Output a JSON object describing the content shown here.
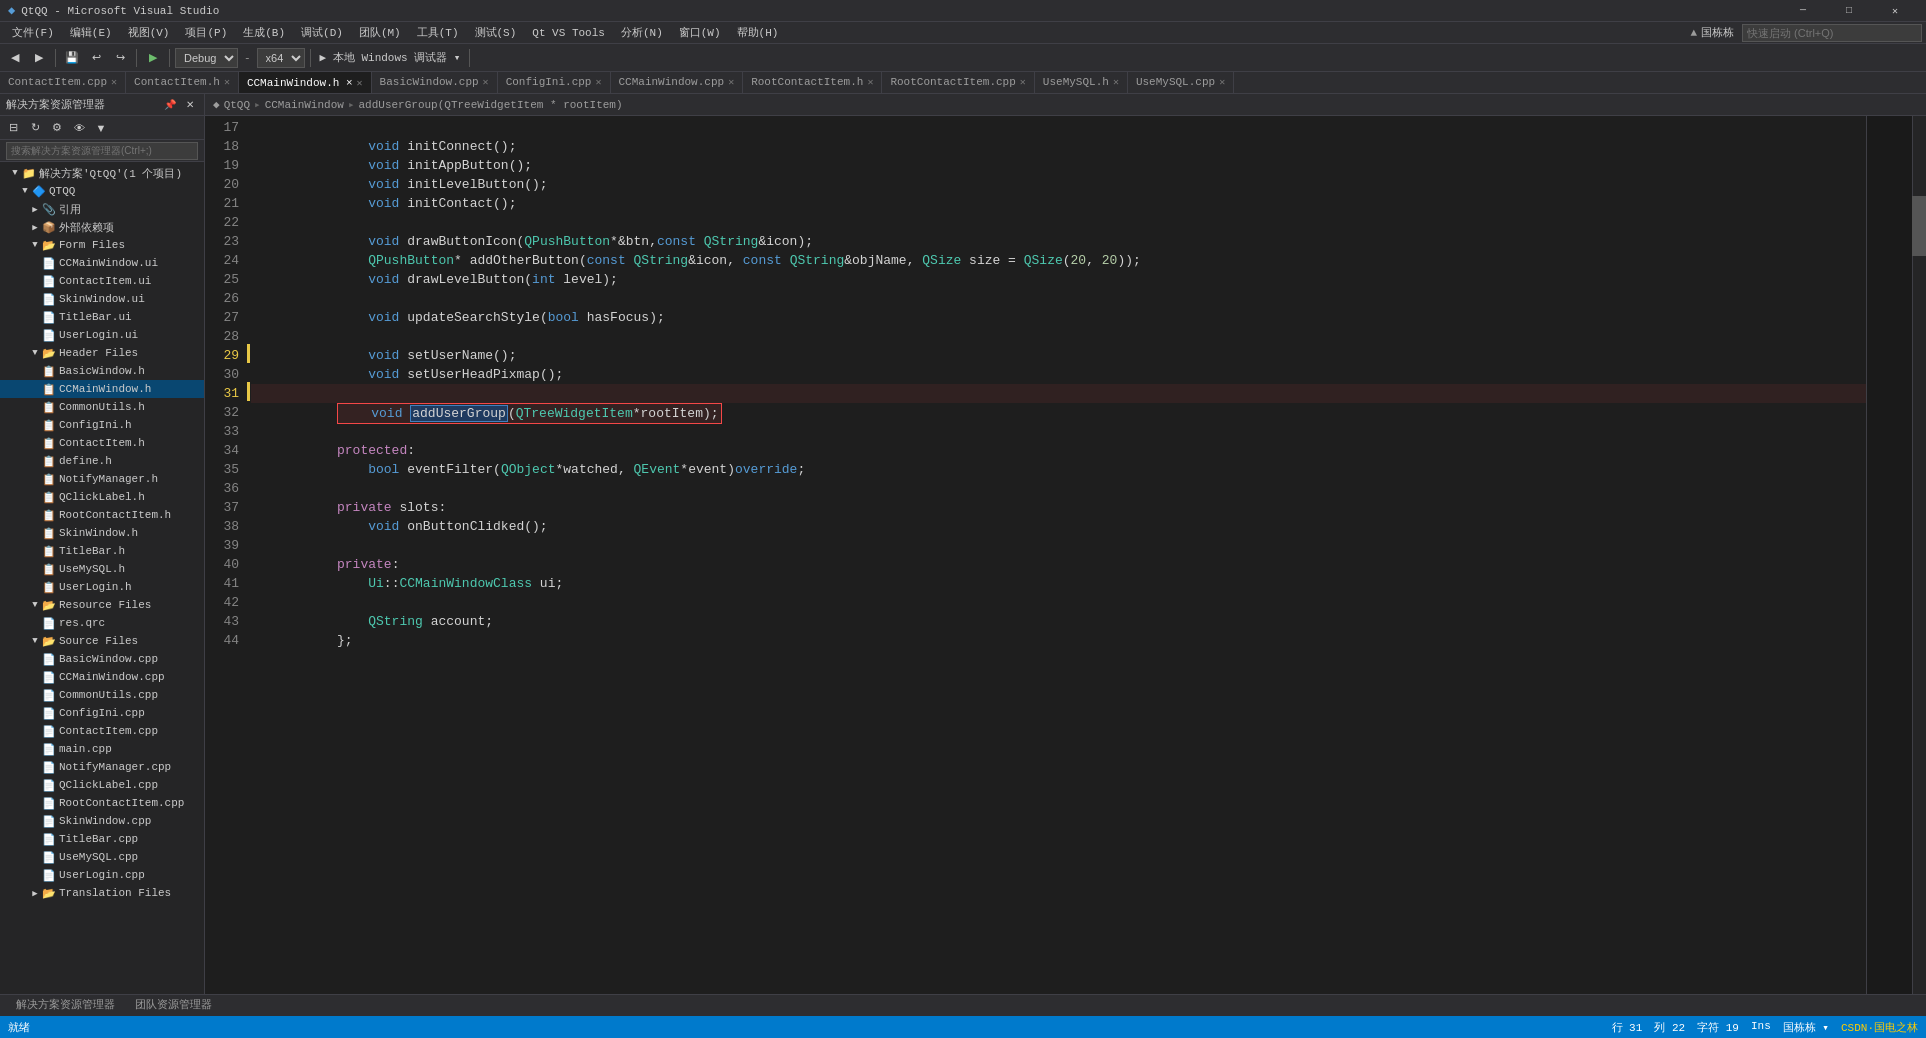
{
  "titleBar": {
    "icon": "◆",
    "title": "QtQQ - Microsoft Visual Studio",
    "btnMinimize": "─",
    "btnMaximize": "□",
    "btnClose": "✕"
  },
  "menuBar": {
    "items": [
      "文件(F)",
      "编辑(E)",
      "视图(V)",
      "项目(P)",
      "生成(B)",
      "调试(D)",
      "团队(M)",
      "工具(T)",
      "测试(S)",
      "Qt VS Tools",
      "分析(N)",
      "窗口(W)",
      "帮助(H)"
    ]
  },
  "toolbar": {
    "debugMode": "Debug",
    "platform": "x64",
    "runTarget": "本地 Windows 调试器",
    "searchPlaceholder": "快速启动 (Ctrl+Q)"
  },
  "tabs": [
    {
      "name": "ContactItem.cpp",
      "active": false,
      "modified": false
    },
    {
      "name": "ContactItem.h",
      "active": false,
      "modified": false
    },
    {
      "name": "CCMainWindow.h",
      "active": true,
      "modified": true
    },
    {
      "name": "BasicWindow.cpp",
      "active": false,
      "modified": false
    },
    {
      "name": "ConfigIni.cpp",
      "active": false,
      "modified": false
    },
    {
      "name": "CCMainWindow.cpp",
      "active": false,
      "modified": false
    },
    {
      "name": "RootContactItem.h",
      "active": false,
      "modified": false
    },
    {
      "name": "RootContactItem.cpp",
      "active": false,
      "modified": false
    },
    {
      "name": "UseMySQL.h",
      "active": false,
      "modified": false
    },
    {
      "name": "UseMySQL.cpp",
      "active": false,
      "modified": false
    }
  ],
  "breadcrumb": {
    "project": "QtQQ",
    "separator1": "▸",
    "class": "CCMainWindow",
    "separator2": "▸",
    "method": "addUserGroup(QTreeWidgetItem * rootItem)"
  },
  "solutionExplorer": {
    "title": "解决方案资源管理器",
    "searchPlaceholder": "搜索解决方案资源管理器(Ctrl+;)",
    "solution": "解决方案'QtQQ'(1 个项目)",
    "project": "QTQQ",
    "tree": [
      {
        "label": "引用",
        "indent": 2,
        "type": "folder",
        "expanded": false
      },
      {
        "label": "外部依赖项",
        "indent": 2,
        "type": "folder",
        "expanded": false
      },
      {
        "label": "Form Files",
        "indent": 2,
        "type": "folder",
        "expanded": true
      },
      {
        "label": "CCMainWindow.ui",
        "indent": 4,
        "type": "file-ui"
      },
      {
        "label": "ContactItem.ui",
        "indent": 4,
        "type": "file-ui"
      },
      {
        "label": "SkinWindow.ui",
        "indent": 4,
        "type": "file-ui"
      },
      {
        "label": "TitleBar.ui",
        "indent": 4,
        "type": "file-ui"
      },
      {
        "label": "UserLogin.ui",
        "indent": 4,
        "type": "file-ui"
      },
      {
        "label": "Header Files",
        "indent": 2,
        "type": "folder",
        "expanded": true
      },
      {
        "label": "BasicWindow.h",
        "indent": 4,
        "type": "file-h"
      },
      {
        "label": "CCMainWindow.h",
        "indent": 4,
        "type": "file-h",
        "selected": true
      },
      {
        "label": "CommonUtils.h",
        "indent": 4,
        "type": "file-h"
      },
      {
        "label": "ConfigIni.h",
        "indent": 4,
        "type": "file-h"
      },
      {
        "label": "ContactItem.h",
        "indent": 4,
        "type": "file-h"
      },
      {
        "label": "define.h",
        "indent": 4,
        "type": "file-h"
      },
      {
        "label": "NotifyManager.h",
        "indent": 4,
        "type": "file-h"
      },
      {
        "label": "QClickLabel.h",
        "indent": 4,
        "type": "file-h"
      },
      {
        "label": "RootContactItem.h",
        "indent": 4,
        "type": "file-h"
      },
      {
        "label": "SkinWindow.h",
        "indent": 4,
        "type": "file-h"
      },
      {
        "label": "TitleBar.h",
        "indent": 4,
        "type": "file-h"
      },
      {
        "label": "UseMySQL.h",
        "indent": 4,
        "type": "file-h"
      },
      {
        "label": "UserLogin.h",
        "indent": 4,
        "type": "file-h"
      },
      {
        "label": "Resource Files",
        "indent": 2,
        "type": "folder",
        "expanded": true
      },
      {
        "label": "res.qrc",
        "indent": 4,
        "type": "file-res"
      },
      {
        "label": "Source Files",
        "indent": 2,
        "type": "folder",
        "expanded": true
      },
      {
        "label": "BasicWindow.cpp",
        "indent": 4,
        "type": "file-cpp"
      },
      {
        "label": "CCMainWindow.cpp",
        "indent": 4,
        "type": "file-cpp"
      },
      {
        "label": "CommonUtils.cpp",
        "indent": 4,
        "type": "file-cpp"
      },
      {
        "label": "ConfigIni.cpp",
        "indent": 4,
        "type": "file-cpp"
      },
      {
        "label": "ContactItem.cpp",
        "indent": 4,
        "type": "file-cpp"
      },
      {
        "label": "main.cpp",
        "indent": 4,
        "type": "file-cpp"
      },
      {
        "label": "NotifyManager.cpp",
        "indent": 4,
        "type": "file-cpp"
      },
      {
        "label": "QClickLabel.cpp",
        "indent": 4,
        "type": "file-cpp"
      },
      {
        "label": "RootContactItem.cpp",
        "indent": 4,
        "type": "file-cpp"
      },
      {
        "label": "SkinWindow.cpp",
        "indent": 4,
        "type": "file-cpp"
      },
      {
        "label": "TitleBar.cpp",
        "indent": 4,
        "type": "file-cpp"
      },
      {
        "label": "UseMySQL.cpp",
        "indent": 4,
        "type": "file-cpp"
      },
      {
        "label": "UserLogin.cpp",
        "indent": 4,
        "type": "file-cpp"
      },
      {
        "label": "Translation Files",
        "indent": 2,
        "type": "folder",
        "expanded": false
      }
    ]
  },
  "codeEditor": {
    "startLine": 17,
    "lines": [
      {
        "num": 17,
        "content": "    <kw>void</kw> initConnect<punct>();</punct>"
      },
      {
        "num": 18,
        "content": "    <kw>void</kw> initAppButton<punct>();</punct>"
      },
      {
        "num": 19,
        "content": "    <kw>void</kw> initLevelButton<punct>();</punct>"
      },
      {
        "num": 20,
        "content": "    <kw>void</kw> initContact<punct>();</punct>"
      },
      {
        "num": 21,
        "content": ""
      },
      {
        "num": 22,
        "content": "    <kw>void</kw> drawButtonIcon<punct>(</punct><type>QPushButton</type><punct>*&</punct>btn<punct>,</punct><kw>const</kw> <type>QString</type><punct>&</punct>icon<punct>);</punct>"
      },
      {
        "num": 23,
        "content": "    <type>QPushButton</type><punct>*</punct> addOtherButton<punct>(</punct><kw>const</kw> <type>QString</type><punct>&</punct>icon<punct>,</punct> <kw>const</kw> <type>QString</type><punct>&</punct>objName<punct>,</punct> <type>QSize</type> size <punct>=</punct> <type>QSize</type><punct>(</punct><num>20</num><punct>,</punct> <num>20</num><punct>));</punct>"
      },
      {
        "num": 24,
        "content": "    <kw>void</kw> drawLevelButton<punct>(</punct><kw>int</kw> level<punct>);</punct>"
      },
      {
        "num": 25,
        "content": ""
      },
      {
        "num": 26,
        "content": "    <kw>void</kw> updateSearchStyle<punct>(</punct><kw>bool</kw> hasFocus<punct>);</punct>"
      },
      {
        "num": 27,
        "content": ""
      },
      {
        "num": 28,
        "content": "    <kw>void</kw> setUserName<punct>();</punct>"
      },
      {
        "num": 29,
        "content": "    <kw>void</kw> setUserHeadPixmap<punct>();</punct>"
      },
      {
        "num": 30,
        "content": ""
      },
      {
        "num": 31,
        "content": "    <kw>void</kw> <span class='highlighted-method'>addUserGroup</span><punct>(</punct><type>QTreeWidgetItem</type><punct>*</punct>rootItem<punct>);</punct>",
        "boxed": true
      },
      {
        "num": 32,
        "content": ""
      },
      {
        "num": 33,
        "content": "<kw2>protected</kw2><punct>:</punct>"
      },
      {
        "num": 34,
        "content": "    <kw>bool</kw> eventFilter<punct>(</punct><type>QObject</type><punct>*</punct>watched<punct>,</punct> <type>QEvent</type><punct>*</punct>event<punct>)</punct><kw>override</kw><punct>;</punct>"
      },
      {
        "num": 35,
        "content": ""
      },
      {
        "num": 36,
        "content": "<kw2>private</kw2> slots<punct>:</punct>"
      },
      {
        "num": 37,
        "content": "    <kw>void</kw> onButtonClidked<punct>();</punct>"
      },
      {
        "num": 38,
        "content": ""
      },
      {
        "num": 39,
        "content": "<kw2>private</kw2><punct>:</punct>"
      },
      {
        "num": 40,
        "content": "    <type>Ui</type><punct>::</punct><type>CCMainWindowClass</type> ui<punct>;</punct>"
      },
      {
        "num": 41,
        "content": ""
      },
      {
        "num": 42,
        "content": "    <type>QString</type> account<punct>;</punct>"
      },
      {
        "num": 43,
        "content": "<punct>};</punct>"
      },
      {
        "num": 44,
        "content": ""
      }
    ]
  },
  "statusBar": {
    "status": "就绪",
    "row": "行 31",
    "col": "列 22",
    "char": "字符 19",
    "ins": "Ins",
    "user": "国栋栋 ▾",
    "csdn": "CSDN·国电之林"
  },
  "bottomTabs": [
    {
      "label": "解决方案资源管理器",
      "active": false
    },
    {
      "label": "团队资源管理器",
      "active": false
    }
  ]
}
